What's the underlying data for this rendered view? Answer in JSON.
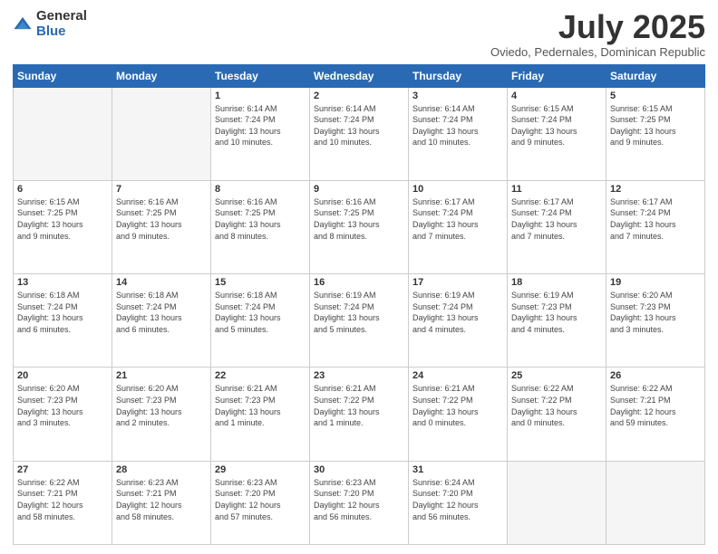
{
  "logo": {
    "general": "General",
    "blue": "Blue"
  },
  "header": {
    "month": "July 2025",
    "subtitle": "Oviedo, Pedernales, Dominican Republic"
  },
  "weekdays": [
    "Sunday",
    "Monday",
    "Tuesday",
    "Wednesday",
    "Thursday",
    "Friday",
    "Saturday"
  ],
  "weeks": [
    [
      {
        "day": "",
        "info": ""
      },
      {
        "day": "",
        "info": ""
      },
      {
        "day": "1",
        "info": "Sunrise: 6:14 AM\nSunset: 7:24 PM\nDaylight: 13 hours\nand 10 minutes."
      },
      {
        "day": "2",
        "info": "Sunrise: 6:14 AM\nSunset: 7:24 PM\nDaylight: 13 hours\nand 10 minutes."
      },
      {
        "day": "3",
        "info": "Sunrise: 6:14 AM\nSunset: 7:24 PM\nDaylight: 13 hours\nand 10 minutes."
      },
      {
        "day": "4",
        "info": "Sunrise: 6:15 AM\nSunset: 7:24 PM\nDaylight: 13 hours\nand 9 minutes."
      },
      {
        "day": "5",
        "info": "Sunrise: 6:15 AM\nSunset: 7:25 PM\nDaylight: 13 hours\nand 9 minutes."
      }
    ],
    [
      {
        "day": "6",
        "info": "Sunrise: 6:15 AM\nSunset: 7:25 PM\nDaylight: 13 hours\nand 9 minutes."
      },
      {
        "day": "7",
        "info": "Sunrise: 6:16 AM\nSunset: 7:25 PM\nDaylight: 13 hours\nand 9 minutes."
      },
      {
        "day": "8",
        "info": "Sunrise: 6:16 AM\nSunset: 7:25 PM\nDaylight: 13 hours\nand 8 minutes."
      },
      {
        "day": "9",
        "info": "Sunrise: 6:16 AM\nSunset: 7:25 PM\nDaylight: 13 hours\nand 8 minutes."
      },
      {
        "day": "10",
        "info": "Sunrise: 6:17 AM\nSunset: 7:24 PM\nDaylight: 13 hours\nand 7 minutes."
      },
      {
        "day": "11",
        "info": "Sunrise: 6:17 AM\nSunset: 7:24 PM\nDaylight: 13 hours\nand 7 minutes."
      },
      {
        "day": "12",
        "info": "Sunrise: 6:17 AM\nSunset: 7:24 PM\nDaylight: 13 hours\nand 7 minutes."
      }
    ],
    [
      {
        "day": "13",
        "info": "Sunrise: 6:18 AM\nSunset: 7:24 PM\nDaylight: 13 hours\nand 6 minutes."
      },
      {
        "day": "14",
        "info": "Sunrise: 6:18 AM\nSunset: 7:24 PM\nDaylight: 13 hours\nand 6 minutes."
      },
      {
        "day": "15",
        "info": "Sunrise: 6:18 AM\nSunset: 7:24 PM\nDaylight: 13 hours\nand 5 minutes."
      },
      {
        "day": "16",
        "info": "Sunrise: 6:19 AM\nSunset: 7:24 PM\nDaylight: 13 hours\nand 5 minutes."
      },
      {
        "day": "17",
        "info": "Sunrise: 6:19 AM\nSunset: 7:24 PM\nDaylight: 13 hours\nand 4 minutes."
      },
      {
        "day": "18",
        "info": "Sunrise: 6:19 AM\nSunset: 7:23 PM\nDaylight: 13 hours\nand 4 minutes."
      },
      {
        "day": "19",
        "info": "Sunrise: 6:20 AM\nSunset: 7:23 PM\nDaylight: 13 hours\nand 3 minutes."
      }
    ],
    [
      {
        "day": "20",
        "info": "Sunrise: 6:20 AM\nSunset: 7:23 PM\nDaylight: 13 hours\nand 3 minutes."
      },
      {
        "day": "21",
        "info": "Sunrise: 6:20 AM\nSunset: 7:23 PM\nDaylight: 13 hours\nand 2 minutes."
      },
      {
        "day": "22",
        "info": "Sunrise: 6:21 AM\nSunset: 7:23 PM\nDaylight: 13 hours\nand 1 minute."
      },
      {
        "day": "23",
        "info": "Sunrise: 6:21 AM\nSunset: 7:22 PM\nDaylight: 13 hours\nand 1 minute."
      },
      {
        "day": "24",
        "info": "Sunrise: 6:21 AM\nSunset: 7:22 PM\nDaylight: 13 hours\nand 0 minutes."
      },
      {
        "day": "25",
        "info": "Sunrise: 6:22 AM\nSunset: 7:22 PM\nDaylight: 13 hours\nand 0 minutes."
      },
      {
        "day": "26",
        "info": "Sunrise: 6:22 AM\nSunset: 7:21 PM\nDaylight: 12 hours\nand 59 minutes."
      }
    ],
    [
      {
        "day": "27",
        "info": "Sunrise: 6:22 AM\nSunset: 7:21 PM\nDaylight: 12 hours\nand 58 minutes."
      },
      {
        "day": "28",
        "info": "Sunrise: 6:23 AM\nSunset: 7:21 PM\nDaylight: 12 hours\nand 58 minutes."
      },
      {
        "day": "29",
        "info": "Sunrise: 6:23 AM\nSunset: 7:20 PM\nDaylight: 12 hours\nand 57 minutes."
      },
      {
        "day": "30",
        "info": "Sunrise: 6:23 AM\nSunset: 7:20 PM\nDaylight: 12 hours\nand 56 minutes."
      },
      {
        "day": "31",
        "info": "Sunrise: 6:24 AM\nSunset: 7:20 PM\nDaylight: 12 hours\nand 56 minutes."
      },
      {
        "day": "",
        "info": ""
      },
      {
        "day": "",
        "info": ""
      }
    ]
  ]
}
